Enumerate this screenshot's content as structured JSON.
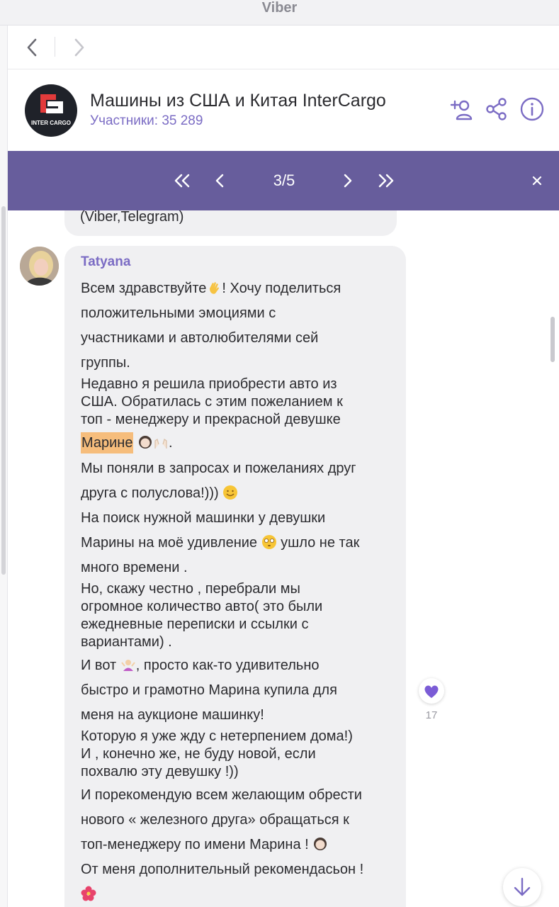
{
  "window": {
    "title": "Viber"
  },
  "nav": {
    "back_icon": "chevron-left-icon",
    "forward_icon": "chevron-right-icon"
  },
  "chat": {
    "title": "Машины из США и Китая InterCargo",
    "subtitle": "Участники: 35 289",
    "logo_text": "INTER CARGO",
    "icons": [
      "add-member-icon",
      "share-icon",
      "info-icon"
    ]
  },
  "search_nav": {
    "counter": "3/5",
    "icons": [
      "double-chevron-left-icon",
      "chevron-left-icon",
      "chevron-right-icon",
      "double-chevron-right-icon",
      "close-icon"
    ],
    "bg_color": "#675d9c"
  },
  "previous_message": {
    "tail_text": "(Viber,Telegram)"
  },
  "message": {
    "sender": "Tatyana",
    "lines": {
      "l1a": "Всем здравствуйте",
      "l1b": "! Хочу поделиться",
      "l2": "положительными эмоциями с",
      "l3": "участниками и автолюбителями сей",
      "l4": "группы.",
      "l5": "Недавно я решила приобрести авто из",
      "l6": "США. Обратилась с этим пожеланием к",
      "l7": "топ - менеджеру и прекрасной девушке",
      "l8_hl": "Марине",
      "l8_end": ".",
      "l9": "Мы поняли в запросах и пожеланиях друг",
      "l10": "друга с полуслова!)))",
      "l11": "На поиск нужной машинки у девушки",
      "l12a": "Марины на моё удивление",
      "l12b": "ушло не так",
      "l13": "много времени .",
      "l14": "Но, скажу честно , перебрали мы",
      "l15": "огромное количество авто( это были",
      "l16": "ежедневные переписки и ссылки с",
      "l17": "вариантами) .",
      "l18a": "И вот",
      "l18b": ", просто как-то удивительно",
      "l19": "быстро и грамотно Марина купила для",
      "l20": "меня на аукционе машинку!",
      "l21": "Которую я уже жду с нетерпением дома!)",
      "l22": "И , конечно же, не буду новой, если",
      "l23": "похвалю эту девушку !))",
      "l24": "И порекомендую всем желающим обрести",
      "l25": "нового « железного друга» обращаться к",
      "l26": "топ-менеджеру по имени  Марина !",
      "l27": "От меня дополнительный рекомендасьон !"
    },
    "emojis": [
      "waving-hand-icon",
      "woman-face-icon",
      "raised-hands-icon",
      "smiling-face-icon",
      "flushed-face-icon",
      "shrugging-woman-icon",
      "woman-face-icon",
      "hibiscus-icon"
    ],
    "likes": {
      "icon": "heart-icon",
      "count": "17",
      "color": "#7b5cd6"
    }
  },
  "scroll_down_icon": "arrow-down-icon",
  "colors": {
    "accent": "#7b6cc4",
    "bubble": "#f0f0f2",
    "highlight": "#f6bd7c"
  }
}
